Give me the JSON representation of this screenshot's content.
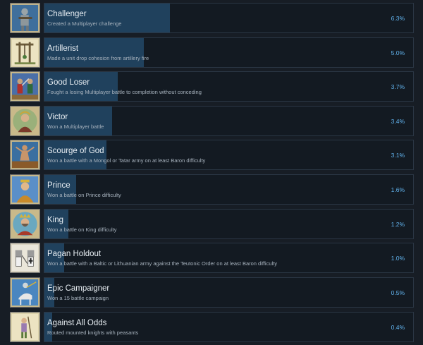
{
  "achievements": [
    {
      "title": "Challenger",
      "description": "Created a Multiplayer challenge",
      "percent": "6.3%",
      "icon": "knight-crossbow-icon",
      "rate": 6.3
    },
    {
      "title": "Artillerist",
      "description": "Made a unit drop cohesion from artillery fire",
      "percent": "5.0%",
      "icon": "trebuchet-icon",
      "rate": 5.0
    },
    {
      "title": "Good Loser",
      "description": "Fought a losing Multiplayer battle to completion without conceding",
      "percent": "3.7%",
      "icon": "dueling-soldiers-icon",
      "rate": 3.7
    },
    {
      "title": "Victor",
      "description": "Won a Multiplayer battle",
      "percent": "3.4%",
      "icon": "victor-portrait-icon",
      "rate": 3.4
    },
    {
      "title": "Scourge of God",
      "description": "Won a battle with a Mongol or Tatar army on at least Baron difficulty",
      "percent": "3.1%",
      "icon": "mongol-warrior-icon",
      "rate": 3.1
    },
    {
      "title": "Prince",
      "description": "Won a battle on Prince difficulty",
      "percent": "1.6%",
      "icon": "prince-portrait-icon",
      "rate": 1.6
    },
    {
      "title": "King",
      "description": "Won a battle on King difficulty",
      "percent": "1.2%",
      "icon": "king-portrait-icon",
      "rate": 1.2
    },
    {
      "title": "Pagan Holdout",
      "description": "Won a battle with a Baltic or Lithuanian army against the Teutonic Order on at least Baron difficulty",
      "percent": "1.0%",
      "icon": "teutonic-knights-icon",
      "rate": 1.0
    },
    {
      "title": "Epic Campaigner",
      "description": "Won a 15 battle campaign",
      "percent": "0.5%",
      "icon": "mounted-knight-icon",
      "rate": 0.5
    },
    {
      "title": "Against All Odds",
      "description": "Routed mounted knights with peasants",
      "percent": "0.4%",
      "icon": "peasant-icon",
      "rate": 0.4
    }
  ]
}
